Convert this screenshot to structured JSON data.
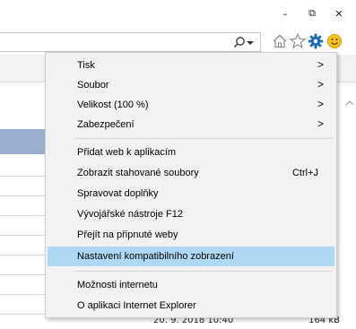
{
  "window": {
    "minimize_glyph": "–",
    "maximize_glyph": "⧉",
    "close_glyph": "✕"
  },
  "toolbar": {
    "icons": [
      "search-icon",
      "dropdown-arrow-icon",
      "home-icon",
      "star-icon",
      "gear-icon",
      "smiley-icon"
    ],
    "gear_color": "#1b6ab3",
    "smiley_color": "#f7c21d"
  },
  "menu": {
    "items": [
      {
        "label": "Tisk",
        "submenu": true
      },
      {
        "label": "Soubor",
        "submenu": true
      },
      {
        "label": "Velikost (100 %)",
        "submenu": true
      },
      {
        "label": "Zabezpečení",
        "submenu": true
      },
      {
        "label": "Přidat web k aplikacím"
      },
      {
        "label": "Zobrazit stahované soubory",
        "shortcut": "Ctrl+J"
      },
      {
        "label": "Spravovat doplňky"
      },
      {
        "label": "Vývojářské nástroje F12"
      },
      {
        "label": "Přejít na připnuté weby"
      },
      {
        "label": "Nastavení kompatibilního zobrazení",
        "highlighted": true
      },
      {
        "label": "Možnosti internetu"
      },
      {
        "label": "O aplikaci Internet Explorer"
      }
    ],
    "submenu_arrow": ">",
    "highlight_color": "#aed8f3"
  },
  "background": {
    "row_date": "20. 9. 2018 10:40",
    "row_size": "164 kB"
  }
}
